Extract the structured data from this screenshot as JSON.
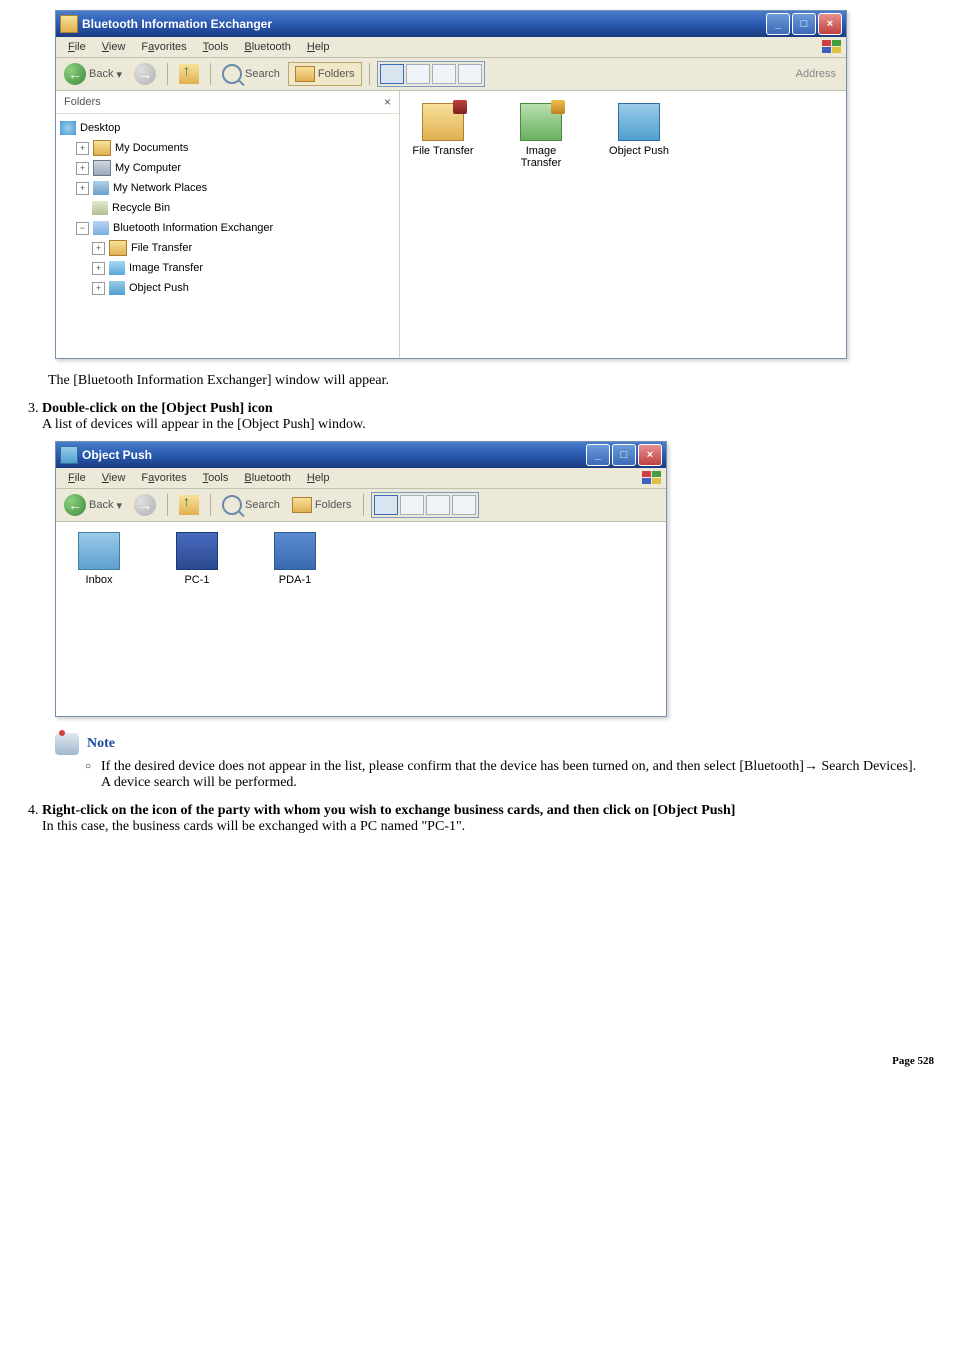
{
  "w1": {
    "title": "Bluetooth Information Exchanger",
    "menu": [
      "File",
      "View",
      "Favorites",
      "Tools",
      "Bluetooth",
      "Help"
    ],
    "menu_keys": [
      "F",
      "V",
      "a",
      "T",
      "B",
      "H"
    ],
    "tb": {
      "back": "Back",
      "search": "Search",
      "folders": "Folders",
      "address": "Address"
    },
    "panel_title": "Folders",
    "tree": {
      "desktop": "Desktop",
      "mydocs": "My Documents",
      "mycomp": "My Computer",
      "mynet": "My Network Places",
      "recycle": "Recycle Bin",
      "btix": "Bluetooth Information Exchanger",
      "ft": "File Transfer",
      "it": "Image Transfer",
      "op": "Object Push"
    },
    "icons": {
      "ft": "File Transfer",
      "it": "Image\nTransfer",
      "op": "Object Push"
    }
  },
  "caption1": "The [Bluetooth Information Exchanger] window will appear.",
  "step3": {
    "title": "Double-click on the [Object Push] icon",
    "sub": "A list of devices will appear in the [Object Push] window."
  },
  "w2": {
    "title": "Object Push",
    "menu": [
      "File",
      "View",
      "Favorites",
      "Tools",
      "Bluetooth",
      "Help"
    ],
    "menu_keys": [
      "F",
      "V",
      "a",
      "T",
      "B",
      "H"
    ],
    "tb": {
      "back": "Back",
      "search": "Search",
      "folders": "Folders"
    },
    "icons": {
      "inbox": "Inbox",
      "pc1": "PC-1",
      "pda1": "PDA-1"
    }
  },
  "note": {
    "label": "Note",
    "text1": "If the desired device does not appear in the list, please confirm that the device has been turned on, and then select [Bluetooth]→ Search Devices].",
    "text2": "A device search will be performed."
  },
  "step4": {
    "title": "Right-click on the icon of the party with whom you wish to exchange business cards, and then click on [Object Push]",
    "sub": "In this case, the business cards will be exchanged with a PC named \"PC-1\"."
  },
  "footer": "Page 528"
}
